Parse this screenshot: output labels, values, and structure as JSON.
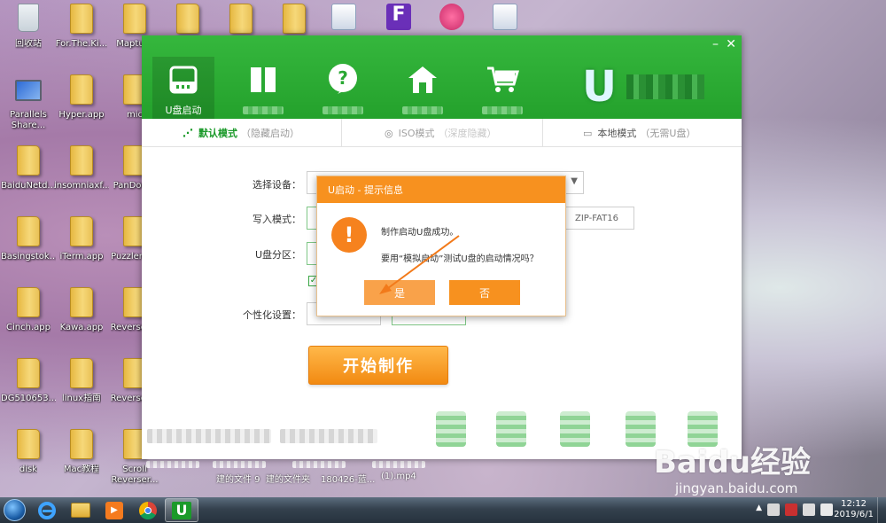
{
  "desktop": {
    "icons": [
      {
        "label": "回收站",
        "type": "recycle"
      },
      {
        "label": "For.The.Ki...",
        "type": "folder"
      },
      {
        "label": "Mapture",
        "type": "folder"
      },
      {
        "label": "",
        "type": "folder"
      },
      {
        "label": "",
        "type": "folder"
      },
      {
        "label": "",
        "type": "folder"
      },
      {
        "label": "",
        "type": "audio"
      },
      {
        "label": "",
        "type": "app-f"
      },
      {
        "label": "",
        "type": "itunes"
      },
      {
        "label": "",
        "type": "audio"
      },
      {
        "label": "Parallels Share...",
        "type": "parallels"
      },
      {
        "label": "Hyper.app",
        "type": "folder"
      },
      {
        "label": "mic",
        "type": "folder"
      },
      {
        "label": "BaiduNetd...",
        "type": "folder"
      },
      {
        "label": "insomniaxf...",
        "type": "folder"
      },
      {
        "label": "PanDow...",
        "type": "folder"
      },
      {
        "label": "Basingstok...",
        "type": "folder"
      },
      {
        "label": "iTerm.app",
        "type": "folder"
      },
      {
        "label": "Puzzler.a...",
        "type": "folder"
      },
      {
        "label": "Cinch.app",
        "type": "folder"
      },
      {
        "label": "Kawa.app",
        "type": "folder"
      },
      {
        "label": "ReverseT...",
        "type": "folder"
      },
      {
        "label": "DG510653...",
        "type": "folder"
      },
      {
        "label": "linux指南",
        "type": "folder"
      },
      {
        "label": "ReverseT...",
        "type": "folder"
      },
      {
        "label": "disk",
        "type": "folder"
      },
      {
        "label": "Mac教程",
        "type": "folder"
      },
      {
        "label": "Scroll Reverser...",
        "type": "folder"
      }
    ],
    "behind_files": [
      "建的文件 9",
      "建的文件夹",
      "180426-蓝...",
      "(1).mp4"
    ]
  },
  "app": {
    "nav": [
      {
        "label": "U盘启动",
        "icon": "usb-drive-icon",
        "active": true
      },
      {
        "label": "",
        "icon": "book-icon",
        "active": false
      },
      {
        "label": "",
        "icon": "help-icon",
        "active": false
      },
      {
        "label": "",
        "icon": "home-icon",
        "active": false
      },
      {
        "label": "",
        "icon": "cart-icon",
        "active": false
      }
    ],
    "window_controls": {
      "minimize": "–",
      "close": "✕"
    },
    "tabs": [
      {
        "label": "默认模式",
        "sub": "（隐藏启动）",
        "active": true
      },
      {
        "label": "ISO模式",
        "sub": "（深度隐藏）",
        "active": false
      },
      {
        "label": "本地模式",
        "sub": "（无需U盘）",
        "active": false
      }
    ],
    "form": {
      "device_label": "选择设备：",
      "write_mode_label": "写入模式：",
      "write_mode_value": "ZIP-FAT16",
      "partition_label": "U盘分区：",
      "personalize_label": "个性化设置：",
      "checkbox_checked": true
    },
    "start_button": "开始制作"
  },
  "dialog": {
    "title": "U启动 - 提示信息",
    "icon_glyph": "!",
    "message_line1": "制作启动U盘成功。",
    "message_line2": "要用“模拟启动”测试U盘的启动情况吗？",
    "yes_label": "是",
    "no_label": "否"
  },
  "watermark": {
    "logo": "Baidu经验",
    "url": "jingyan.baidu.com"
  },
  "taskbar": {
    "apps": [
      "ie-icon",
      "file-explorer-icon",
      "media-player-icon",
      "chrome-icon",
      "uqidong-icon"
    ],
    "clock_time": "12:12",
    "clock_date": "2019/6/1"
  },
  "colors": {
    "header_green": "#2aa833",
    "accent_orange": "#f7911f",
    "tab_active_green": "#1b9a2a"
  }
}
